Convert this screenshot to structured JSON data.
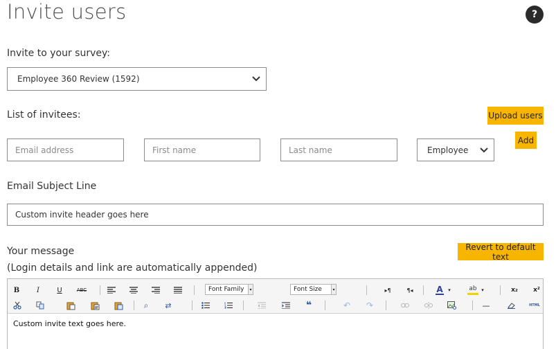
{
  "header": {
    "title": "Invite users",
    "help_glyph": "?"
  },
  "survey": {
    "label": "Invite to your survey:",
    "selected": "Employee 360 Review (1592)"
  },
  "invitees": {
    "label": "List of invitees:",
    "upload_label": "Upload users",
    "email_placeholder": "Email address",
    "first_name_placeholder": "First name",
    "last_name_placeholder": "Last name",
    "role_selected": "Employee",
    "add_label": "Add"
  },
  "subject": {
    "label": "Email Subject Line",
    "value": "Custom invite header goes here"
  },
  "message": {
    "label": "Your message",
    "note": "(Login details and link are automatically appended)",
    "revert_label": "Revert to default text",
    "body": "Custom invite text goes here."
  },
  "toolbar": {
    "bold": "B",
    "italic": "I",
    "underline": "U",
    "strike": "ABC",
    "font_family": "Font Family",
    "font_size": "Font Size",
    "ltr": "▸¶",
    "rtl": "¶◂",
    "font_color": "A",
    "highlight": "ab",
    "subscript": "x₂",
    "superscript": "x²",
    "find": "⌕",
    "replace": "⇄",
    "blockquote": "❝",
    "undo": "↶",
    "redo": "↷",
    "hr": "—",
    "html": "HTML"
  },
  "colors": {
    "accent": "#f7b500",
    "help_bg": "#2b2b2b",
    "border": "#8a8a8a"
  }
}
